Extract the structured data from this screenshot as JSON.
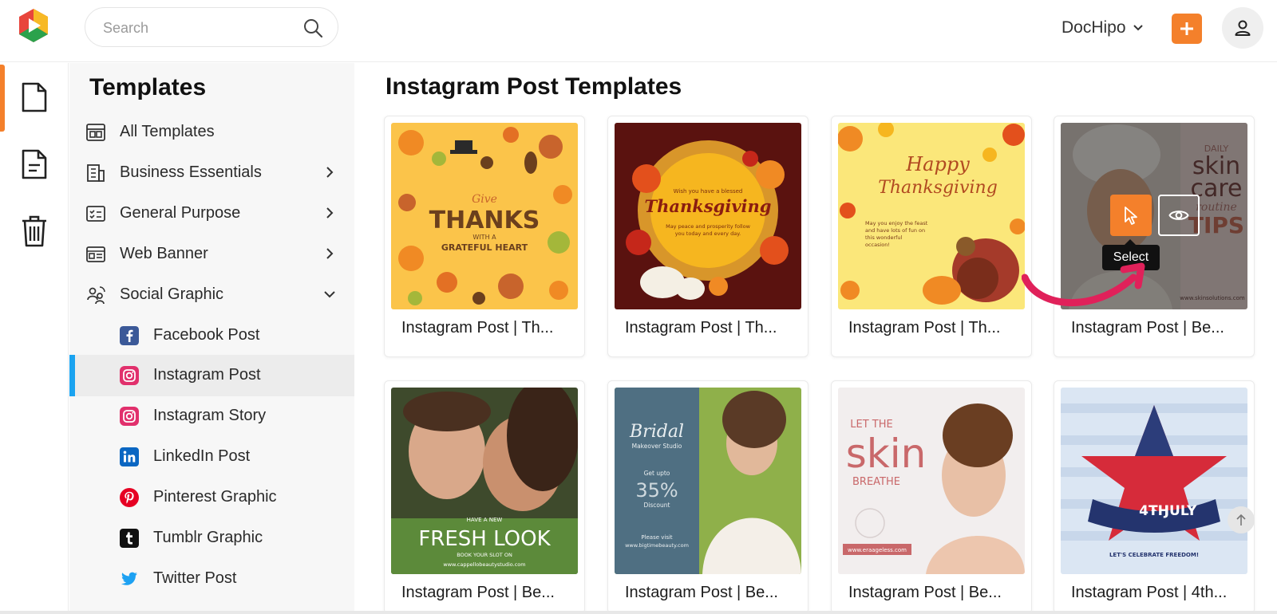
{
  "topbar": {
    "search_placeholder": "Search",
    "workspace_label": "DocHipo",
    "accent_color": "#f4802b"
  },
  "rail": {
    "items": [
      {
        "icon": "document-icon",
        "active": true
      },
      {
        "icon": "file-text-icon",
        "active": false
      },
      {
        "icon": "trash-icon",
        "active": false
      }
    ]
  },
  "sidebar": {
    "title": "Templates",
    "items": [
      {
        "label": "All Templates",
        "icon": "layout-grid-icon"
      },
      {
        "label": "Business Essentials",
        "icon": "building-icon",
        "expandable": true
      },
      {
        "label": "General Purpose",
        "icon": "checklist-icon",
        "expandable": true
      },
      {
        "label": "Web Banner",
        "icon": "banner-icon",
        "expandable": true
      },
      {
        "label": "Social Graphic",
        "icon": "social-users-icon",
        "expanded": true
      }
    ],
    "sub_items": [
      {
        "label": "Facebook Post",
        "icon": "facebook-icon",
        "color": "#3b5998"
      },
      {
        "label": "Instagram Post",
        "icon": "instagram-icon",
        "color": "#e1306c",
        "selected": true
      },
      {
        "label": "Instagram Story",
        "icon": "instagram-icon",
        "color": "#e1306c"
      },
      {
        "label": "LinkedIn Post",
        "icon": "linkedin-icon",
        "color": "#0a66c2"
      },
      {
        "label": "Pinterest Graphic",
        "icon": "pinterest-icon",
        "color": "#e60023"
      },
      {
        "label": "Tumblr Graphic",
        "icon": "tumblr-icon",
        "color": "#111111"
      },
      {
        "label": "Twitter Post",
        "icon": "twitter-icon",
        "color": "#1da1f2"
      }
    ],
    "selected_color": "#1aa3f0"
  },
  "main": {
    "title": "Instagram Post Templates",
    "tooltip": "Select",
    "cards": [
      {
        "caption": "Instagram Post | Th...",
        "thumb": {
          "line1": "Give",
          "line2": "THANKS",
          "line3": "WITH A",
          "line4": "GRATEFUL HEART"
        }
      },
      {
        "caption": "Instagram Post | Th...",
        "thumb": {
          "line1": "Wish you have a blessed",
          "line2": "Thanksgiving",
          "line3": "May peace and prosperity follow",
          "line4": "you today and every day."
        }
      },
      {
        "caption": "Instagram Post | Th...",
        "thumb": {
          "line1": "Happy",
          "line2": "Thanksgiving",
          "line3": "May you enjoy the feast",
          "line4": "and have lots of fun on",
          "line5": "this wonderful",
          "line6": "occasion!"
        }
      },
      {
        "caption": "Instagram Post | Be...",
        "thumb": {
          "line1": "DAILY",
          "line2": "skin",
          "line3": "care",
          "line4": "routine",
          "line5": "TIPS",
          "line6": "www.skinsolutions.com"
        }
      },
      {
        "caption": "Instagram Post | Be...",
        "thumb": {
          "line1": "HAVE A NEW",
          "line2": "FRESH LOOK",
          "line3": "BOOK YOUR SLOT ON",
          "line4": "www.cappellobeautystudio.com"
        }
      },
      {
        "caption": "Instagram Post | Be...",
        "thumb": {
          "line1": "Bridal",
          "line2": "Makeover Studio",
          "line3": "Get upto",
          "line4": "35%",
          "line5": "Discount",
          "line6": "Please visit",
          "line7": "www.bigtimebeauty.com"
        }
      },
      {
        "caption": "Instagram Post | Be...",
        "thumb": {
          "line1": "LET THE",
          "line2": "skin",
          "line3": "BREATHE",
          "line4": "www.eraageless.com"
        }
      },
      {
        "caption": "Instagram Post | 4th...",
        "thumb": {
          "line1": "4TH",
          "line2": "JULY",
          "line3": "LET'S CELEBRATE FREEDOM!"
        }
      }
    ]
  }
}
